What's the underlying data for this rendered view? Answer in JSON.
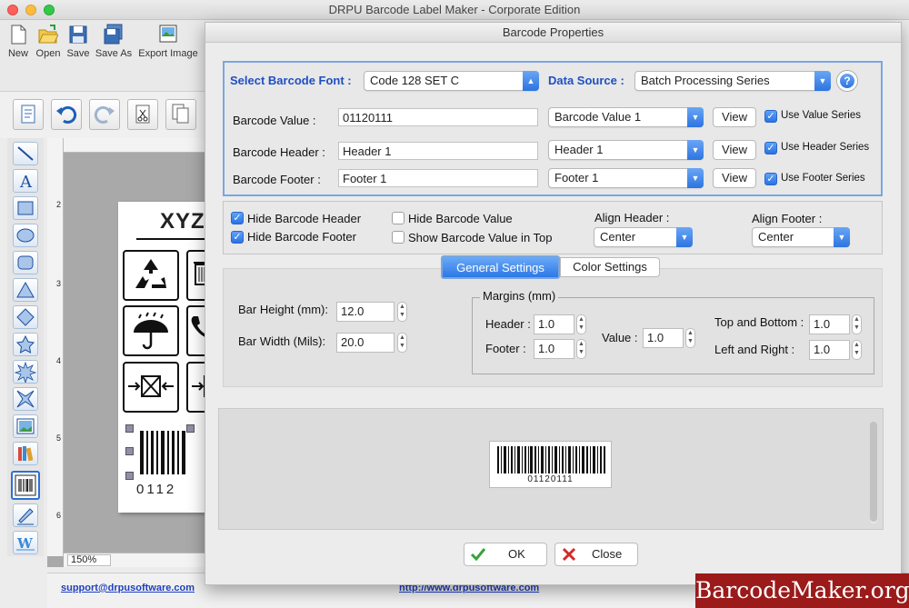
{
  "app": {
    "title": "DRPU Barcode Label Maker - Corporate Edition"
  },
  "toolbar": {
    "buttons": [
      {
        "label": "New",
        "icon": "new-file-icon"
      },
      {
        "label": "Open",
        "icon": "open-folder-icon"
      },
      {
        "label": "Save",
        "icon": "save-icon"
      },
      {
        "label": "Save As",
        "icon": "save-as-icon"
      },
      {
        "label": "Export Image",
        "icon": "export-image-icon"
      }
    ]
  },
  "canvas": {
    "zoom": "150%",
    "label_header": "XYZ",
    "label_barcode_text": "0112",
    "ruler_marks": [
      "2",
      "3",
      "4",
      "5",
      "6"
    ]
  },
  "footer": {
    "support_link": "support@drpusoftware.com",
    "web_link": "http://www.drpusoftware.com"
  },
  "watermark": "BarcodeMaker.org",
  "dialog": {
    "title": "Barcode Properties",
    "select_font_label": "Select Barcode Font :",
    "font_value": "Code 128 SET C",
    "data_source_label": "Data Source :",
    "data_source_value": "Batch Processing Series",
    "help": "?",
    "rows": [
      {
        "label": "Barcode Value :",
        "input": "01120111",
        "select": "Barcode Value 1",
        "view": "View",
        "check": "Use Value Series"
      },
      {
        "label": "Barcode Header :",
        "input": "Header 1",
        "select": "Header 1",
        "view": "View",
        "check": "Use Header Series"
      },
      {
        "label": "Barcode Footer :",
        "input": "Footer 1",
        "select": "Footer 1",
        "view": "View",
        "check": "Use Footer Series"
      }
    ],
    "options": {
      "hide_header": "Hide Barcode Header",
      "hide_footer": "Hide Barcode Footer",
      "hide_value": "Hide Barcode Value",
      "show_value_top": "Show Barcode Value in Top",
      "align_header_label": "Align Header :",
      "align_header_value": "Center",
      "align_footer_label": "Align Footer :",
      "align_footer_value": "Center"
    },
    "tabs": [
      "General Settings",
      "Color Settings"
    ],
    "general": {
      "bar_height_label": "Bar Height (mm):",
      "bar_height": "12.0",
      "bar_width_label": "Bar Width (Mils):",
      "bar_width": "20.0",
      "margins_title": "Margins (mm)",
      "header_label": "Header :",
      "header": "1.0",
      "footer_label": "Footer :",
      "footer": "1.0",
      "value_label": "Value :",
      "value": "1.0",
      "top_bottom_label": "Top and Bottom :",
      "top_bottom": "1.0",
      "left_right_label": "Left and Right :",
      "left_right": "1.0"
    },
    "preview_value": "01120111",
    "ok": "OK",
    "close": "Close"
  }
}
